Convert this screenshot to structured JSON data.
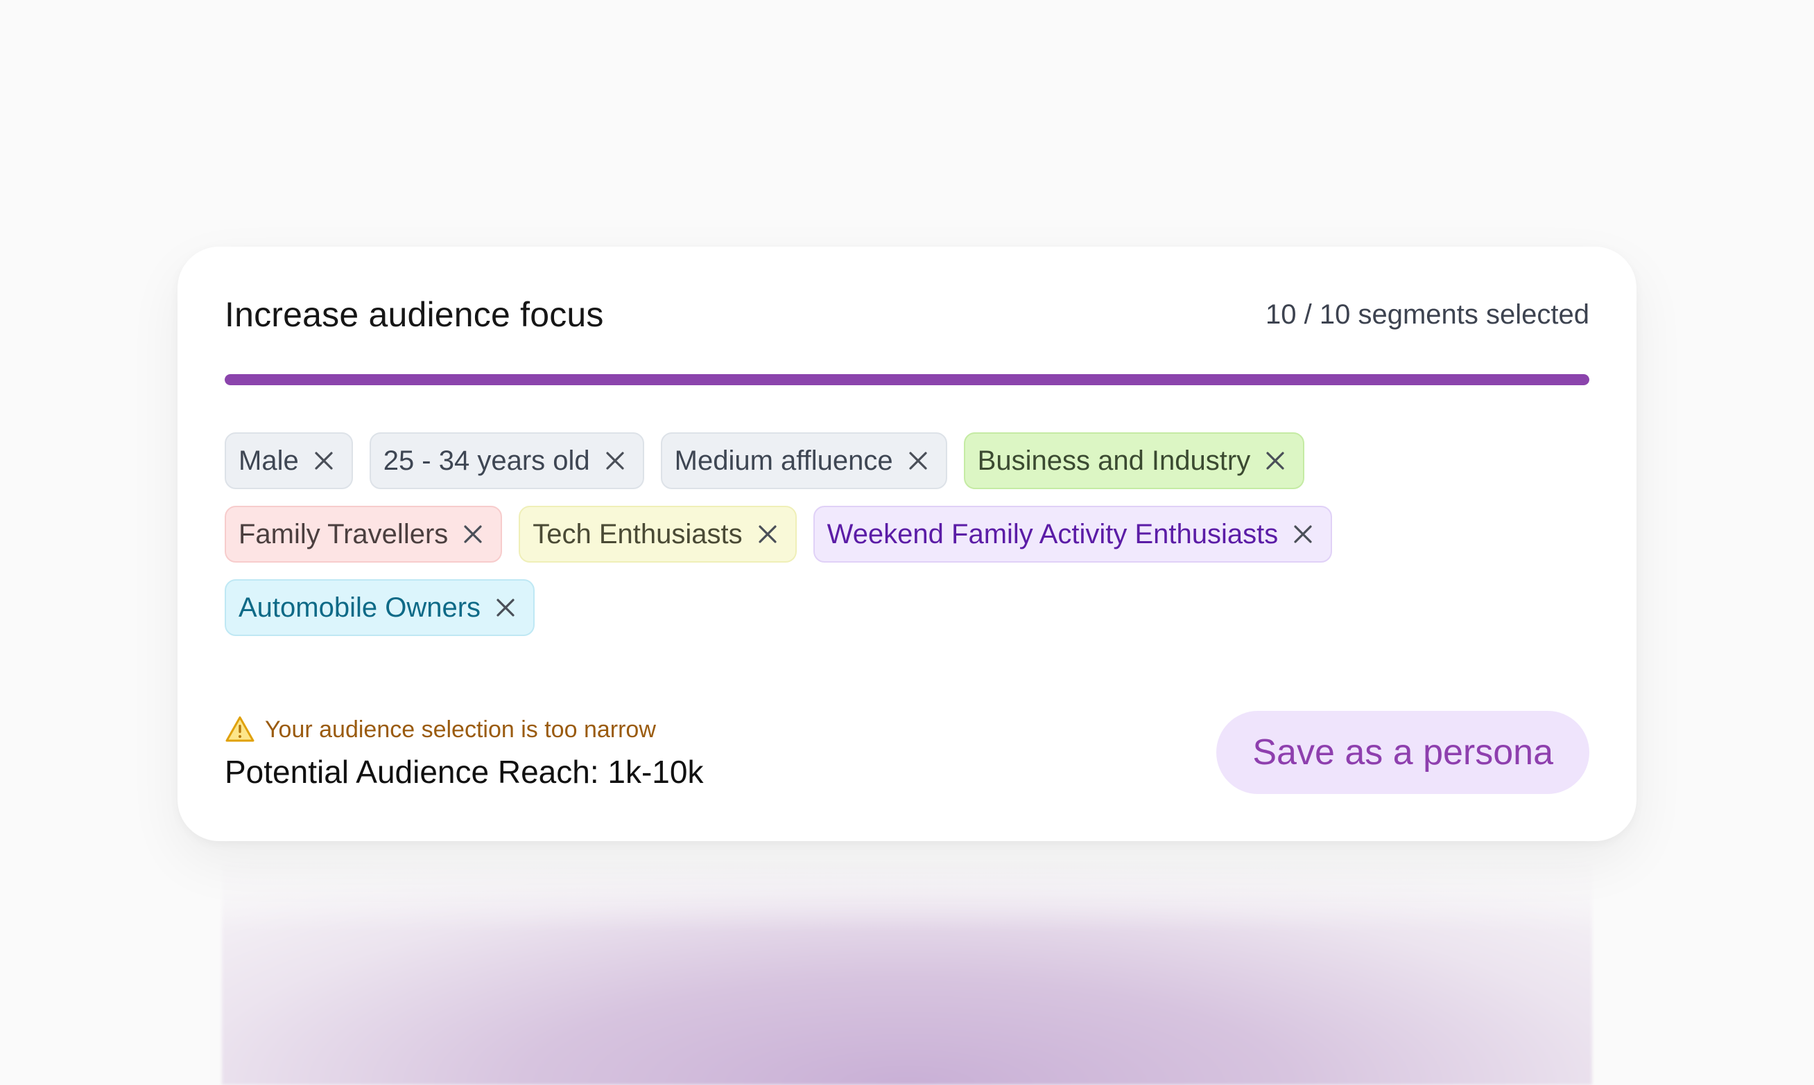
{
  "card": {
    "title": "Increase audience focus",
    "counter": "10 / 10 segments selected",
    "progress_fraction": 1.0,
    "accent_color": "#8b44ac"
  },
  "chips": [
    {
      "label": "Male",
      "color": "gray"
    },
    {
      "label": "25 - 34 years old",
      "color": "gray"
    },
    {
      "label": "Medium affluence",
      "color": "gray"
    },
    {
      "label": "Business and Industry",
      "color": "green"
    },
    {
      "label": "Family Travellers",
      "color": "red"
    },
    {
      "label": "Tech Enthusiasts",
      "color": "yellow"
    },
    {
      "label": "Weekend Family Activity Enthusiasts",
      "color": "purple"
    },
    {
      "label": "Automobile Owners",
      "color": "cyan"
    }
  ],
  "chip_remove_icon": "close-icon",
  "footer": {
    "warning_icon": "warning-triangle-icon",
    "warning_text": "Your audience selection is too narrow",
    "reach_text": "Potential Audience Reach: 1k-10k",
    "save_label": "Save as a persona"
  }
}
